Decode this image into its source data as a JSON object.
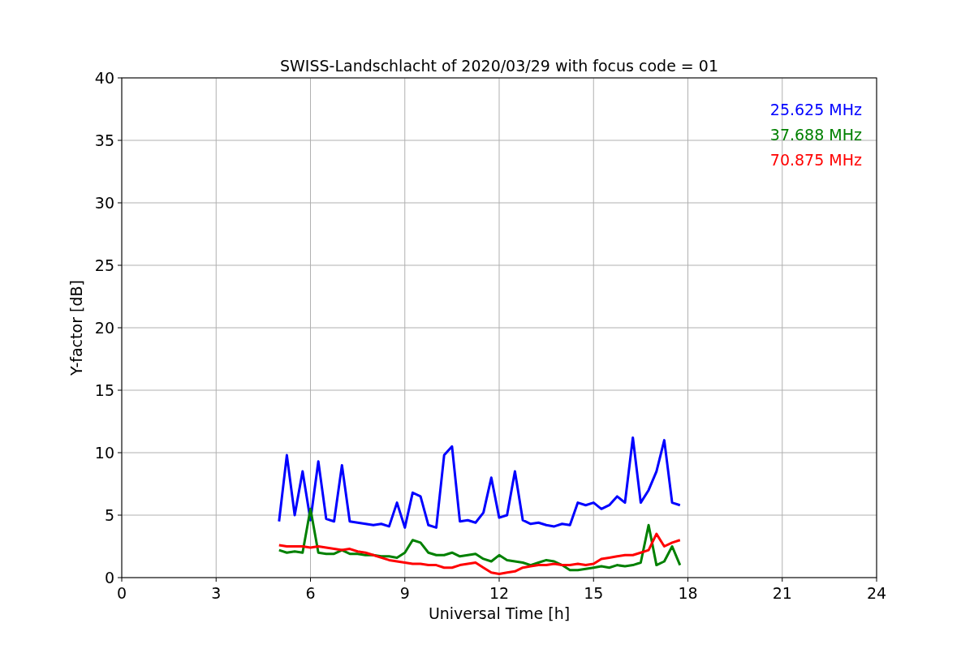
{
  "chart_data": {
    "type": "line",
    "title": "SWISS-Landschlacht of 2020/03/29 with focus code = 01",
    "xlabel": "Universal Time [h]",
    "ylabel": "Y-factor [dB]",
    "x": [
      5,
      5.25,
      5.5,
      5.75,
      6,
      6.25,
      6.5,
      6.75,
      7,
      7.25,
      7.5,
      7.75,
      8,
      8.25,
      8.5,
      8.75,
      9,
      9.25,
      9.5,
      9.75,
      10,
      10.25,
      10.5,
      10.75,
      11,
      11.25,
      11.5,
      11.75,
      12,
      12.25,
      12.5,
      12.75,
      13,
      13.25,
      13.5,
      13.75,
      14,
      14.25,
      14.5,
      14.75,
      15,
      15.25,
      15.5,
      15.75,
      16,
      16.25,
      16.5,
      16.75,
      17,
      17.25,
      17.5,
      17.75
    ],
    "series": [
      {
        "name": "25.625 MHz",
        "color": "#0000ff",
        "values": [
          4.5,
          9.8,
          5.0,
          8.5,
          4.6,
          9.3,
          4.7,
          4.5,
          9.0,
          4.5,
          4.4,
          4.3,
          4.2,
          4.3,
          4.1,
          6.0,
          4.0,
          6.8,
          6.5,
          4.2,
          4.0,
          9.8,
          10.5,
          4.5,
          4.6,
          4.4,
          5.2,
          8.0,
          4.8,
          5.0,
          8.5,
          4.6,
          4.3,
          4.4,
          4.2,
          4.1,
          4.3,
          4.2,
          6.0,
          5.8,
          6.0,
          5.5,
          5.8,
          6.5,
          6.0,
          11.2,
          6.0,
          7.0,
          8.5,
          11.0,
          6.0,
          5.8
        ]
      },
      {
        "name": "37.688 MHz",
        "color": "#008000",
        "values": [
          2.2,
          2.0,
          2.1,
          2.0,
          5.5,
          2.0,
          1.9,
          1.9,
          2.2,
          1.9,
          1.9,
          1.8,
          1.8,
          1.7,
          1.7,
          1.6,
          2.0,
          3.0,
          2.8,
          2.0,
          1.8,
          1.8,
          2.0,
          1.7,
          1.8,
          1.9,
          1.5,
          1.3,
          1.8,
          1.4,
          1.3,
          1.2,
          1.0,
          1.2,
          1.4,
          1.3,
          1.0,
          0.6,
          0.6,
          0.7,
          0.8,
          0.9,
          0.8,
          1.0,
          0.9,
          1.0,
          1.2,
          4.2,
          1.0,
          1.3,
          2.5,
          1.0
        ]
      },
      {
        "name": "70.875 MHz",
        "color": "#ff0000",
        "values": [
          2.6,
          2.5,
          2.5,
          2.5,
          2.4,
          2.5,
          2.4,
          2.3,
          2.2,
          2.3,
          2.1,
          2.0,
          1.8,
          1.6,
          1.4,
          1.3,
          1.2,
          1.1,
          1.1,
          1.0,
          1.0,
          0.8,
          0.8,
          1.0,
          1.1,
          1.2,
          0.8,
          0.4,
          0.3,
          0.4,
          0.5,
          0.8,
          0.9,
          1.0,
          1.0,
          1.1,
          1.0,
          1.0,
          1.1,
          1.0,
          1.1,
          1.5,
          1.6,
          1.7,
          1.8,
          1.8,
          2.0,
          2.2,
          3.5,
          2.5,
          2.8,
          3.0
        ]
      }
    ],
    "grid": true,
    "xlim": [
      0,
      24
    ],
    "ylim": [
      0,
      40
    ],
    "xticks": [
      0,
      3,
      6,
      9,
      12,
      15,
      18,
      21,
      24
    ],
    "yticks": [
      0,
      5,
      10,
      15,
      20,
      25,
      30,
      35,
      40
    ]
  }
}
